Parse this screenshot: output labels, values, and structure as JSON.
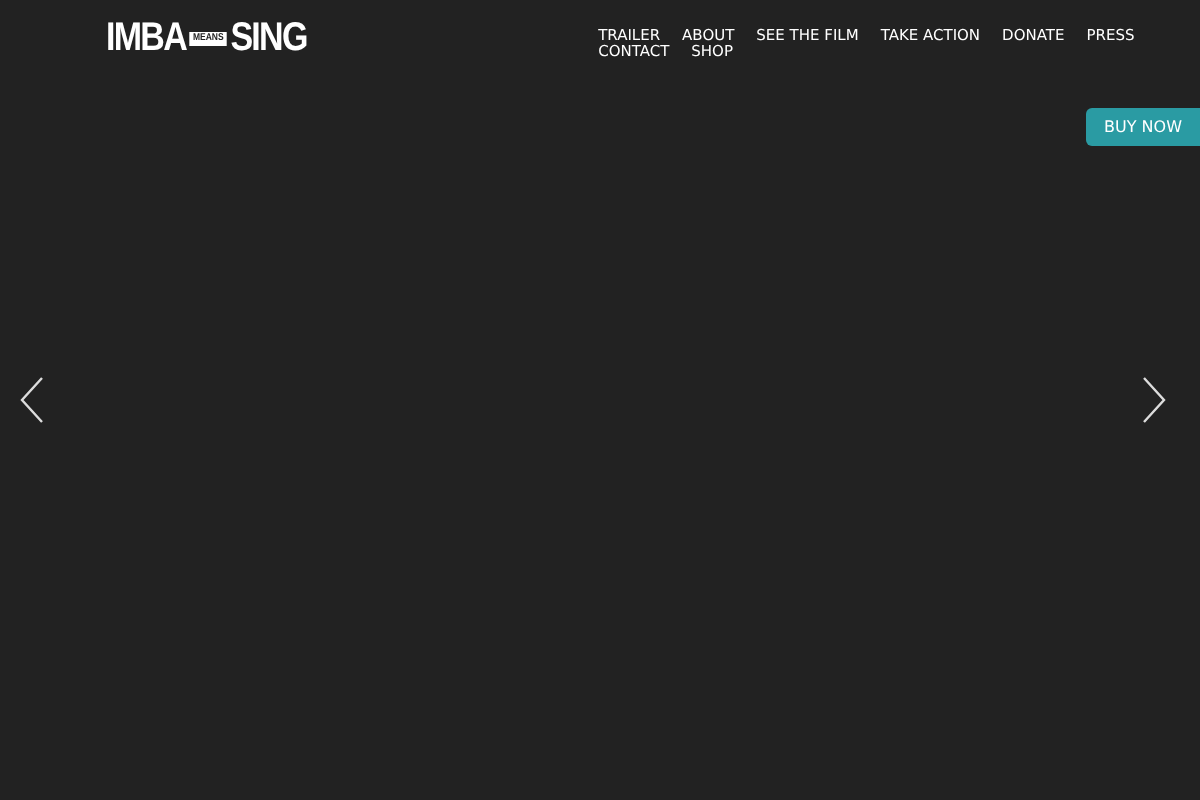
{
  "logo": {
    "left": "IMBA",
    "middle": "MEANS",
    "right": "SING"
  },
  "nav": [
    "TRAILER",
    "ABOUT",
    "SEE THE FILM",
    "TAKE ACTION",
    "DONATE",
    "PRESS",
    "CONTACT",
    "SHOP"
  ],
  "buy_button": "BUY NOW"
}
